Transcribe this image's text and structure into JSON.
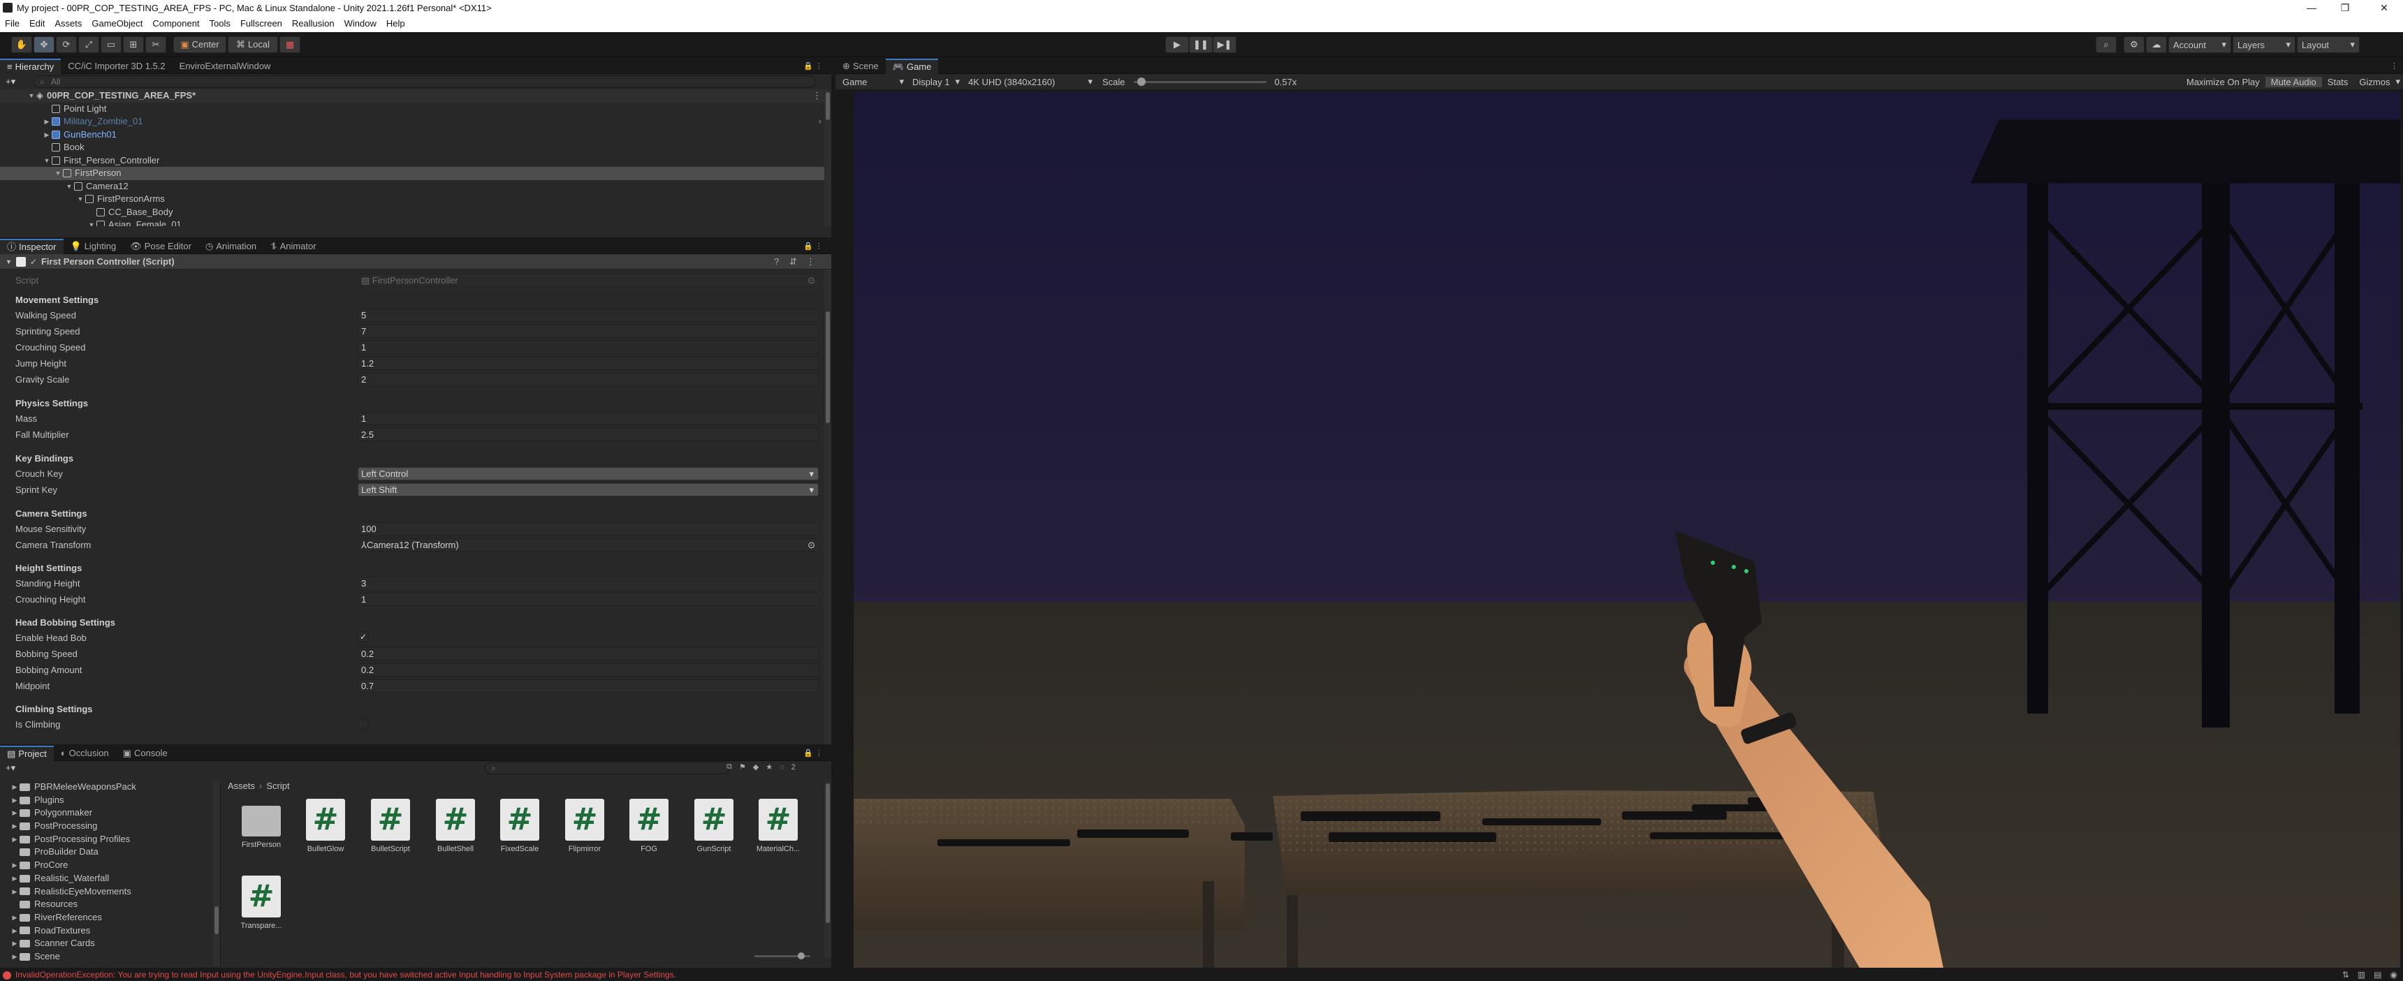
{
  "window": {
    "title": "My project - 00PR_COP_TESTING_AREA_FPS - PC, Mac & Linux Standalone - Unity 2021.1.26f1 Personal* <DX11>",
    "minimize": "—",
    "maximize": "❐",
    "close": "✕"
  },
  "menu": [
    "File",
    "Edit",
    "Assets",
    "GameObject",
    "Component",
    "Tools",
    "Fullscreen",
    "Reallusion",
    "Window",
    "Help"
  ],
  "toolbar": {
    "pivot_label": "Center",
    "space_label": "Local",
    "account_label": "Account",
    "layers_label": "Layers",
    "layout_label": "Layout"
  },
  "hierarchy": {
    "tabs": [
      "Hierarchy",
      "CC/iC Importer 3D 1.5.2",
      "EnviroExternalWindow"
    ],
    "search_placeholder": "All",
    "scene_name": "00PR_COP_TESTING_AREA_FPS*",
    "items": [
      {
        "label": "Point Light"
      },
      {
        "label": "Military_Zombie_01"
      },
      {
        "label": "GunBench01"
      },
      {
        "label": "Book"
      },
      {
        "label": "First_Person_Controller"
      },
      {
        "label": "FirstPerson"
      },
      {
        "label": "Camera12"
      },
      {
        "label": "FirstPersonArms"
      },
      {
        "label": "CC_Base_Body"
      },
      {
        "label": "Asian_Female_01"
      }
    ]
  },
  "inspector": {
    "tabs": [
      "Inspector",
      "Lighting",
      "Pose Editor",
      "Animation",
      "Animator"
    ],
    "component_title": "First Person Controller (Script)",
    "script_label": "Script",
    "script_value": "FirstPersonController",
    "sections": {
      "movement": "Movement Settings",
      "physics": "Physics Settings",
      "keys": "Key Bindings",
      "camera": "Camera Settings",
      "height": "Height Settings",
      "bob": "Head Bobbing Settings",
      "climb": "Climbing Settings"
    },
    "fields": {
      "walking_speed": {
        "label": "Walking Speed",
        "value": "5"
      },
      "sprinting_speed": {
        "label": "Sprinting Speed",
        "value": "7"
      },
      "crouching_speed": {
        "label": "Crouching Speed",
        "value": "1"
      },
      "jump_height": {
        "label": "Jump Height",
        "value": "1.2"
      },
      "gravity_scale": {
        "label": "Gravity Scale",
        "value": "2"
      },
      "mass": {
        "label": "Mass",
        "value": "1"
      },
      "fall_multiplier": {
        "label": "Fall Multiplier",
        "value": "2.5"
      },
      "crouch_key": {
        "label": "Crouch Key",
        "value": "Left Control"
      },
      "sprint_key": {
        "label": "Sprint Key",
        "value": "Left Shift"
      },
      "mouse_sensitivity": {
        "label": "Mouse Sensitivity",
        "value": "100"
      },
      "camera_transform": {
        "label": "Camera Transform",
        "value": "Camera12 (Transform)"
      },
      "standing_height": {
        "label": "Standing Height",
        "value": "3"
      },
      "crouching_height": {
        "label": "Crouching Height",
        "value": "1"
      },
      "enable_head_bob": {
        "label": "Enable Head Bob",
        "value": "✓"
      },
      "bobbing_speed": {
        "label": "Bobbing Speed",
        "value": "0.2"
      },
      "bobbing_amount": {
        "label": "Bobbing Amount",
        "value": "0.2"
      },
      "midpoint": {
        "label": "Midpoint",
        "value": "0.7"
      },
      "is_climbing": {
        "label": "Is Climbing",
        "value": ""
      }
    }
  },
  "project": {
    "tabs": [
      "Project",
      "Occlusion",
      "Console"
    ],
    "breadcrumb": [
      "Assets",
      "Script"
    ],
    "count": "2",
    "folders": [
      "PBRMeleeWeaponsPack",
      "Plugins",
      "Polygonmaker",
      "PostProcessing",
      "PostProcessing Profiles",
      "ProBuilder Data",
      "ProCore",
      "Realistic_Waterfall",
      "RealisticEyeMovements",
      "Resources",
      "RiverReferences",
      "RoadTextures",
      "Scanner Cards",
      "Scene"
    ],
    "assets": [
      "FirstPerson",
      "BulletGlow",
      "BulletScript",
      "BulletShell",
      "FixedScale",
      "Flipmirror",
      "FOG",
      "GunScript",
      "MaterialCh...",
      "Transpare..."
    ],
    "script_glyph": "#"
  },
  "game": {
    "tabs": [
      "Scene",
      "Game"
    ],
    "display_mode": "Game",
    "display": "Display 1",
    "resolution": "4K UHD (3840x2160)",
    "scale_label": "Scale",
    "scale_value": "0.57x",
    "options": [
      "Maximize On Play",
      "Mute Audio",
      "Stats",
      "Gizmos"
    ],
    "scale_fraction": 0.03
  },
  "status": {
    "error": "InvalidOperationException: You are trying to read Input using the UnityEngine.Input class, but you have switched active Input handling to Input System package in Player Settings."
  },
  "colors": {
    "accent": "#3a79bb",
    "error": "#e04b4b",
    "sky": "#1a1636",
    "ground": "#2a2622"
  }
}
